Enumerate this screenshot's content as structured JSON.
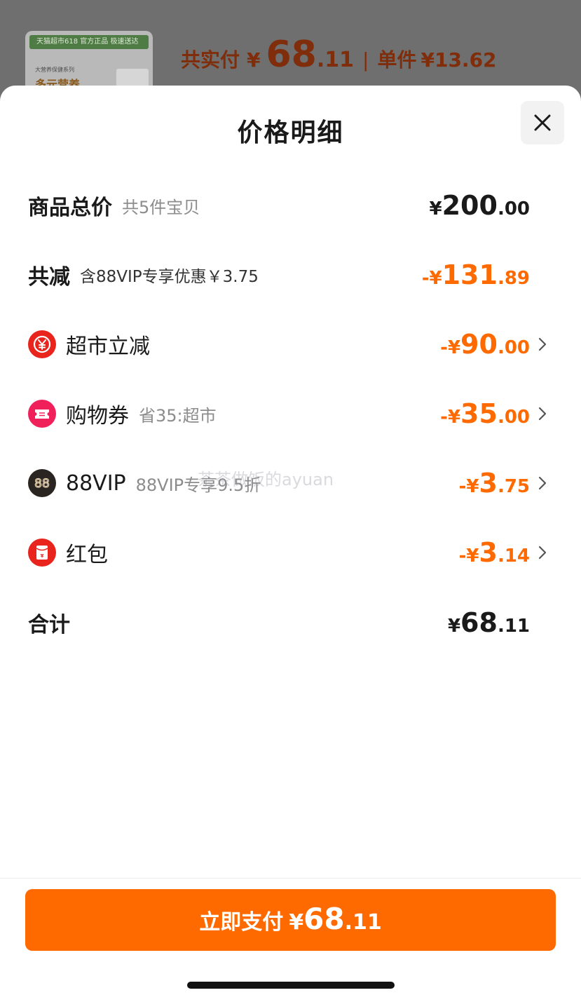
{
  "background": {
    "product_banner": "天猫超市618 官方正品 极速送达",
    "product_sub": "大营养保健系列",
    "product_big": "多元营养",
    "price_label": "共实付",
    "price_currency": "¥",
    "price_int": "68",
    "price_dec": ".11",
    "separator": "|",
    "unit_label": "单件",
    "unit_value": "¥13.62"
  },
  "sheet": {
    "title": "价格明细",
    "close_icon": "close-icon"
  },
  "rows": [
    {
      "label": "商品总价",
      "sub": "共5件宝贝",
      "pre": "¥",
      "int": "200",
      "dec": ".00",
      "color": "#1a1a1a"
    },
    {
      "label": "共减",
      "sub": "含88VIP专享优惠￥3.75",
      "pre": "-¥",
      "int": "131",
      "dec": ".89",
      "color": "#ff6a00"
    },
    {
      "label": "超市立减",
      "sub": "",
      "pre": "-¥",
      "int": "90",
      "dec": ".00",
      "icon": "yuan-coin-icon",
      "color": "#ff6a00"
    },
    {
      "label": "购物券",
      "sub": "省35:超市",
      "pre": "-¥",
      "int": "35",
      "dec": ".00",
      "icon": "ticket-icon",
      "color": "#ff6a00"
    },
    {
      "label": "88VIP",
      "sub": "88VIP专享9.5折",
      "pre": "-¥",
      "int": "3",
      "dec": ".75",
      "icon": "vip88-icon",
      "color": "#ff6a00"
    },
    {
      "label": "红包",
      "sub": "",
      "pre": "-¥",
      "int": "3",
      "dec": ".14",
      "icon": "red-envelope-icon",
      "color": "#ff6a00"
    },
    {
      "label": "合计",
      "sub": "",
      "pre": "¥",
      "int": "68",
      "dec": ".11",
      "color": "#1a1a1a"
    }
  ],
  "watermark": "茶茶做饭的ayuan",
  "pay_button": {
    "label": "立即支付",
    "currency": "¥",
    "int": "68",
    "dec": ".11",
    "color": "#ff6a00"
  }
}
